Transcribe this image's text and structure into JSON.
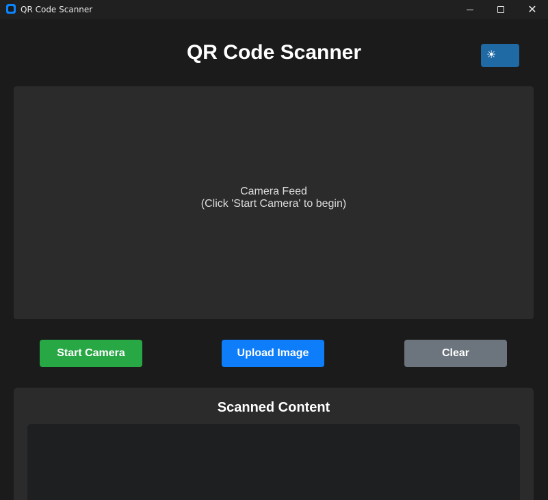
{
  "window": {
    "title": "QR Code Scanner",
    "controls": {
      "minimize": "minimize",
      "maximize": "maximize",
      "close": "✕"
    }
  },
  "header": {
    "title": "QR Code Scanner",
    "theme_toggle_icon": "☀"
  },
  "camera": {
    "line1": "Camera Feed",
    "line2": "(Click 'Start Camera' to begin)"
  },
  "buttons": {
    "start": "Start Camera",
    "upload": "Upload Image",
    "clear": "Clear"
  },
  "scanned": {
    "title": "Scanned Content",
    "text": ""
  },
  "colors": {
    "background": "#1b1b1b",
    "panel": "#2b2b2b",
    "start_green": "#28a745",
    "upload_blue": "#0d7dfa",
    "clear_gray": "#6c757d",
    "toggle_blue": "#1f6aa5"
  }
}
